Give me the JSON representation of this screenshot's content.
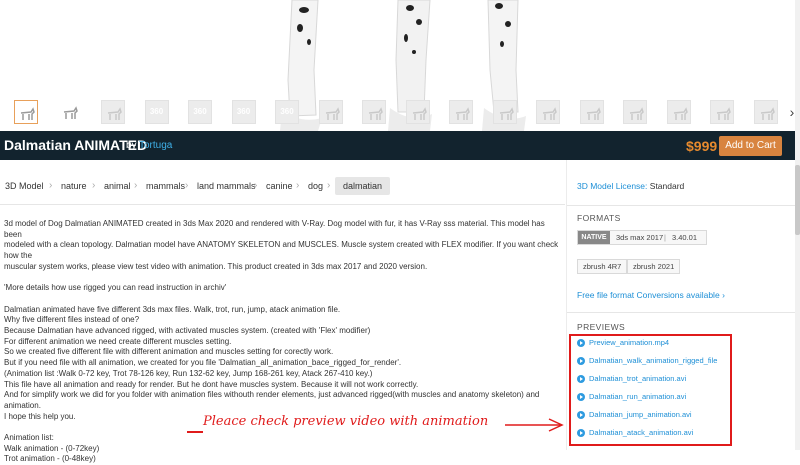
{
  "header": {
    "title": "Dalmatian ANIMATED",
    "by": "by",
    "author": "Tortuga",
    "price": "$999",
    "cart_label": "Add to Cart"
  },
  "thumbnails": {
    "count": 18,
    "badges": [
      "",
      "",
      "",
      "360",
      "360",
      "360",
      "360",
      "",
      "",
      "",
      "",
      "",
      "",
      "",
      "",
      "",
      "",
      ""
    ]
  },
  "breadcrumb": [
    "3D Model",
    "nature",
    "animal",
    "mammals",
    "land mammals",
    "canine",
    "dog",
    "dalmatian"
  ],
  "description": [
    "3d model of Dog Dalmatian ANIMATED created in 3ds Max 2020 and rendered with V-Ray. Dog model with fur, it has V-Ray sss material. This model has been",
    "modeled with a clean topology. Dalmatian model have ANATOMY SKELETON and MUSCLES. Muscle system created with FLEX modifier. If you want check how the",
    "muscular system works, please view test video with animation. This product created in 3ds max 2017 and 2020 version.",
    "",
    "'More details how use rigged you can read instruction in archiv'",
    "",
    "Dalmatian animated have five different 3ds max files. Walk, trot, run, jump, atack animation file.",
    "Why five different files instead of one?",
    "Because Dalmatian have advanced rigged, with activated muscles system. (created with 'Flex' modifier)",
    "For different animation we need create different muscles setting.",
    "So we created five different file with different animation and muscles setting for corectly work.",
    "But if you need file with all animation, we created for you file 'Dalmatian_all_animation_bace_rigged_for_render'.",
    "(Animation list :Walk 0-72 key, Trot 78-126 key, Run 132-62 key, Jump 168-261 key, Atack 267-410 key.)",
    "This file have all animation and ready for render. But he dont have muscles system. Because it will not work correctly.",
    "And for simplify work we did for you folder with animation files withouth render elements, just advanced rigged(with muscles and anatomy skeleton) and animation.",
    "I hope this help you.",
    "",
    "Animation list:",
    "Walk animation - (0-72key)",
    "Trot animation - (0-48key)"
  ],
  "license": {
    "link": "3D Model License:",
    "value": "Standard"
  },
  "formats": {
    "heading": "FORMATS",
    "native_badge": "NATIVE",
    "native_name": "3ds max 2017",
    "native_version": "3.40.01",
    "others": [
      "zbrush 4R7",
      "zbrush 2021"
    ],
    "conversions": "Free file format Conversions available"
  },
  "previews": {
    "heading": "PREVIEWS",
    "items": [
      "Preview_animation.mp4",
      "Dalmatian_walk_animation_rigged_file",
      "Dalmatian_trot_animation.avi",
      "Dalmatian_run_animation.avi",
      "Dalmatian_jump_animation.avi",
      "Dalmatian_atack_animation.avi"
    ]
  },
  "annotation": {
    "text": "Pleace check preview video with animation",
    "color": "#e01b1b"
  },
  "colors": {
    "accent": "#1d8fd6",
    "price": "#e68a2e",
    "title_bar": "#12232e",
    "cart": "#d8843f"
  }
}
